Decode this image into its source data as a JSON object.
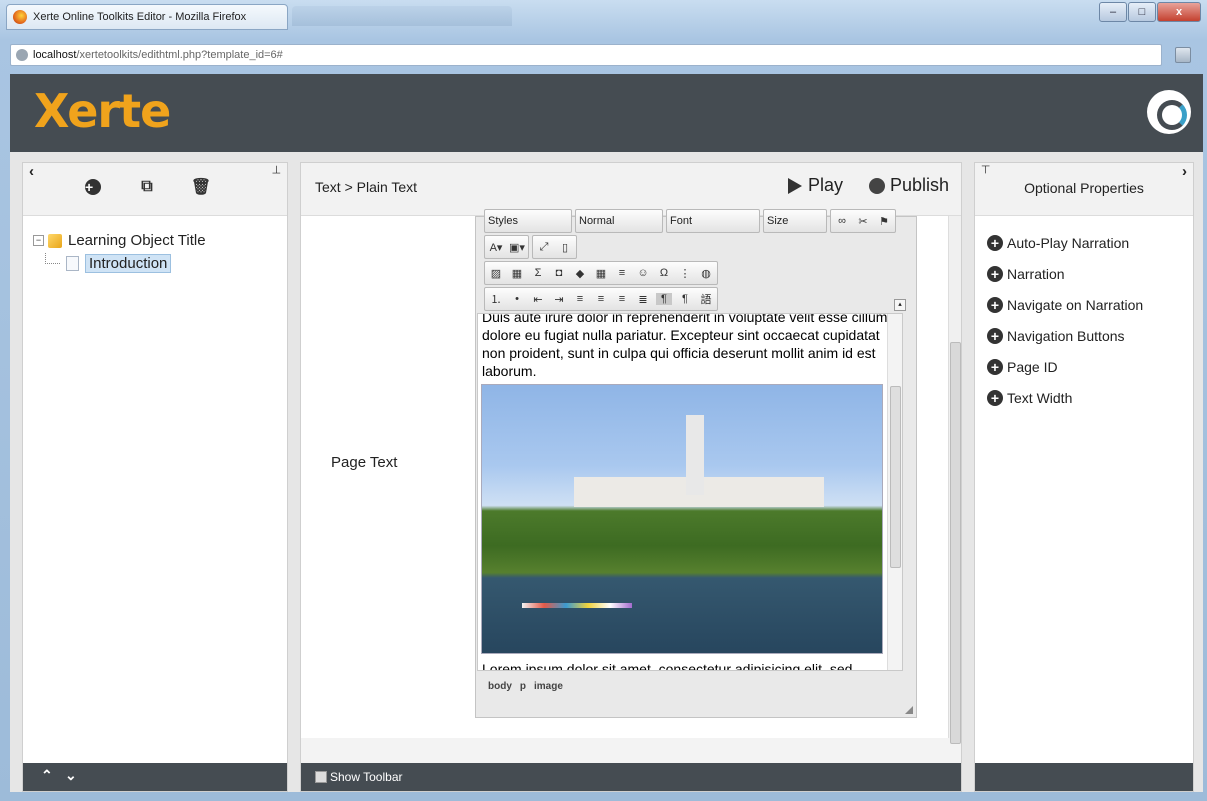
{
  "browser": {
    "window_title": "Xerte Online Toolkits Editor - Mozilla Firefox",
    "url_host": "localhost",
    "url_path": "/xertetoolkits/edithtml.php?template_id=6#",
    "buttons": {
      "minimize": "–",
      "maximize": "□",
      "close": "x"
    }
  },
  "app": {
    "logo_text": "Xerte",
    "colors": {
      "header": "#454c52",
      "logo": "#f0a31c"
    }
  },
  "left_panel": {
    "tree": [
      {
        "label": "Learning Object Title",
        "level": 0
      },
      {
        "label": "Introduction",
        "level": 1,
        "selected": true
      }
    ]
  },
  "middle_panel": {
    "breadcrumb": "Text > Plain Text",
    "play_label": "Play",
    "publish_label": "Publish",
    "field_label": "Page Text",
    "show_toolbar_label": "Show Toolbar",
    "editor": {
      "text_before": "Duis aute irure dolor in reprehenderit in voluptate velit esse cillum dolore eu fugiat nulla pariatur. Excepteur sint occaecat cupidatat non proident, sunt in culpa qui officia deserunt mollit anim id est laborum.",
      "text_after": "Lorem ipsum dolor sit amet, consectetur adipisicing elit, sed",
      "status_path": [
        "body",
        "p",
        "image"
      ],
      "dropdowns": [
        "Styles",
        "Normal",
        "Font",
        "Size"
      ]
    }
  },
  "right_panel": {
    "title": "Optional Properties",
    "items": [
      "Auto-Play Narration",
      "Narration",
      "Navigate on Narration",
      "Navigation Buttons",
      "Page ID",
      "Text Width"
    ]
  }
}
